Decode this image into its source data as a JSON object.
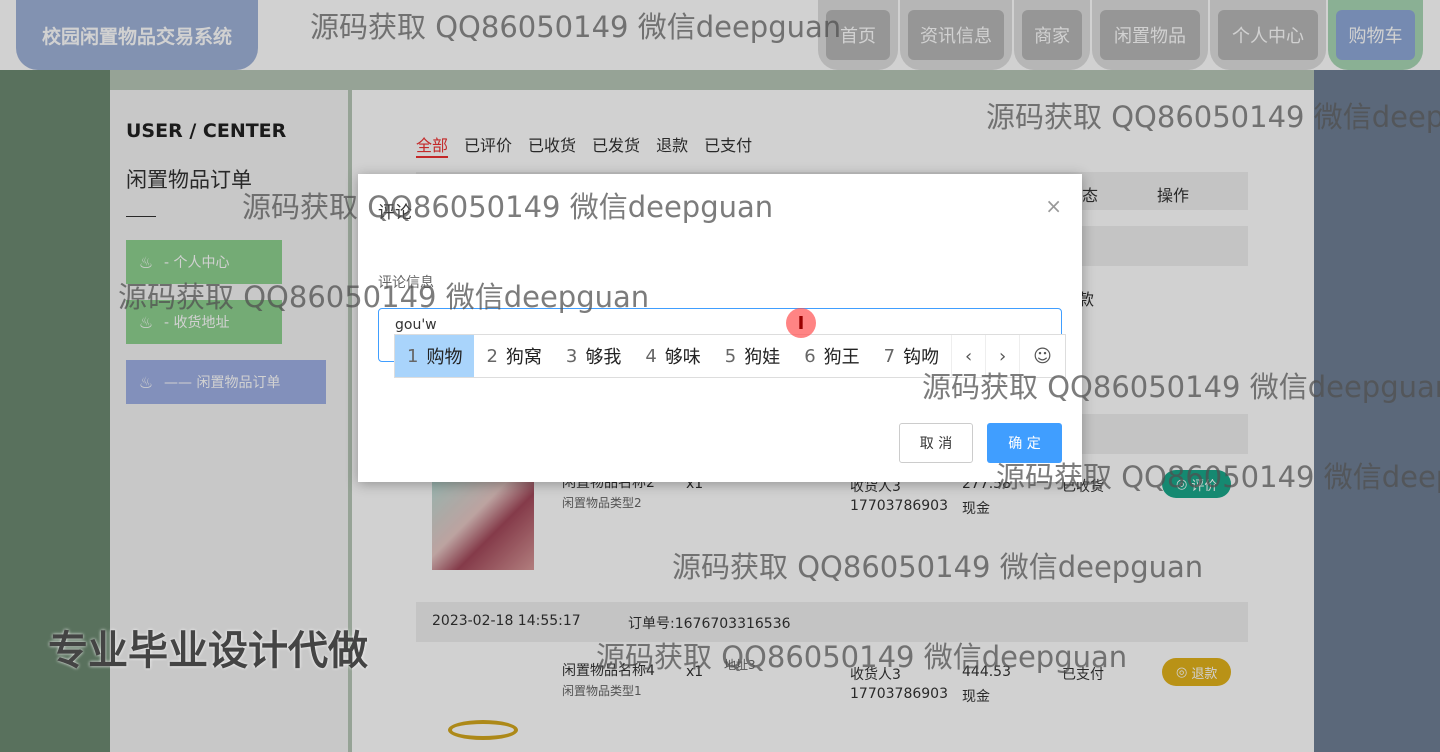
{
  "header": {
    "logo": "校园闲置物品交易系统",
    "nav": [
      "首页",
      "资讯信息",
      "商家",
      "闲置物品",
      "个人中心",
      "购物车"
    ]
  },
  "sidebar": {
    "title": "USER / CENTER",
    "subtitle": "闲置物品订单",
    "items": [
      "-  个人中心",
      "-  收货地址",
      "——  闲置物品订单"
    ]
  },
  "tabs": [
    "全部",
    "已评价",
    "已收货",
    "已发货",
    "退款",
    "已支付"
  ],
  "table_headers": {
    "status": "态",
    "actions": "操作"
  },
  "orders": [
    {
      "status_word": "款"
    },
    {
      "name": "闲置物品名称2",
      "type": "闲置物品类型2",
      "qty": "x1",
      "receiver": "收货人3",
      "phone": "17703786903",
      "price": "277.58",
      "pay": "现金",
      "status": "已收货",
      "action": "评价"
    },
    {
      "time": "2023-02-18 14:55:17",
      "order_no": "订单号:1676703316536",
      "name": "闲置物品名称4",
      "type": "闲置物品类型1",
      "qty": "x1",
      "addr": "地址3",
      "receiver": "收货人3",
      "phone": "17703786903",
      "price": "444.53",
      "pay": "现金",
      "status": "已支付",
      "action": "退款"
    }
  ],
  "dialog": {
    "title": "评论",
    "label": "评论信息",
    "input_value": "gou'w",
    "candidates": [
      {
        "n": "1",
        "w": "购物"
      },
      {
        "n": "2",
        "w": "狗窝"
      },
      {
        "n": "3",
        "w": "够我"
      },
      {
        "n": "4",
        "w": "够味"
      },
      {
        "n": "5",
        "w": "狗娃"
      },
      {
        "n": "6",
        "w": "狗王"
      },
      {
        "n": "7",
        "w": "钩吻"
      }
    ],
    "cancel": "取 消",
    "ok": "确 定"
  },
  "watermark": "源码获取 QQ86050149 微信deepguan",
  "watermark_big": "专业毕业设计代做",
  "colors": {
    "accent": "#409eff",
    "logo_bg": "#9fb2d8",
    "ok_green": "#1aa88a",
    "refund_yellow": "#e2b21c"
  }
}
